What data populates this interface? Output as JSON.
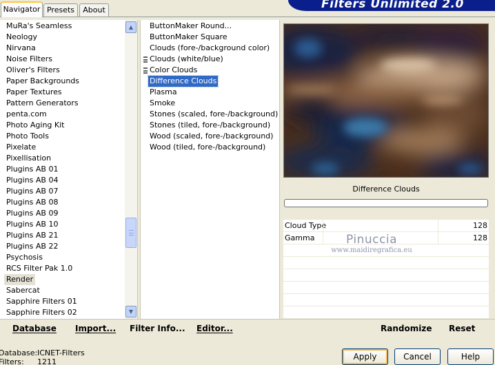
{
  "tabs": [
    {
      "label": "Navigator"
    },
    {
      "label": "Presets"
    },
    {
      "label": "About"
    }
  ],
  "banner": {
    "title": "Filters Unlimited 2.0"
  },
  "categories": [
    {
      "label": "MuRa's Seamless"
    },
    {
      "label": "Neology"
    },
    {
      "label": "Nirvana"
    },
    {
      "label": "Noise Filters"
    },
    {
      "label": "Oliver's Filters"
    },
    {
      "label": "Paper Backgrounds"
    },
    {
      "label": "Paper Textures"
    },
    {
      "label": "Pattern Generators"
    },
    {
      "label": "penta.com"
    },
    {
      "label": "Photo Aging Kit"
    },
    {
      "label": "Photo Tools"
    },
    {
      "label": "Pixelate"
    },
    {
      "label": "Pixellisation"
    },
    {
      "label": "Plugins AB 01"
    },
    {
      "label": "Plugins AB 04"
    },
    {
      "label": "Plugins AB 07"
    },
    {
      "label": "Plugins AB 08"
    },
    {
      "label": "Plugins AB 09"
    },
    {
      "label": "Plugins AB 10"
    },
    {
      "label": "Plugins AB 21"
    },
    {
      "label": "Plugins AB 22"
    },
    {
      "label": "Psychosis"
    },
    {
      "label": "RCS Filter Pak 1.0"
    },
    {
      "label": "Render"
    },
    {
      "label": "Sabercat"
    },
    {
      "label": "Sapphire Filters 01"
    },
    {
      "label": "Sapphire Filters 02"
    }
  ],
  "filters": [
    {
      "label": "ButtonMaker Round..."
    },
    {
      "label": "ButtonMaker Square"
    },
    {
      "label": "Clouds (fore-/background color)"
    },
    {
      "label": "Clouds (white/blue)"
    },
    {
      "label": "Color Clouds"
    },
    {
      "label": "Difference Clouds"
    },
    {
      "label": "Plasma"
    },
    {
      "label": "Smoke"
    },
    {
      "label": "Stones (scaled, fore-/background)"
    },
    {
      "label": "Stones (tiled, fore-/background)"
    },
    {
      "label": "Wood (scaled, fore-/background)"
    },
    {
      "label": "Wood (tiled, fore-/background)"
    }
  ],
  "preview": {
    "filter_name": "Difference Clouds"
  },
  "params": [
    {
      "name": "Cloud Type",
      "value": "128"
    },
    {
      "name": "Gamma",
      "value": "128"
    }
  ],
  "watermark": {
    "name": "Pinuccia",
    "url": "www.maidiregrafica.eu"
  },
  "actions": {
    "database": "Database",
    "import": "Import...",
    "filter_info": "Filter Info...",
    "editor": "Editor...",
    "randomize": "Randomize",
    "reset": "Reset"
  },
  "status": {
    "database_label": "Database:",
    "database_value": "ICNET-Filters",
    "filters_label": "Filters:",
    "filters_value": "1211"
  },
  "buttons": {
    "apply": "Apply",
    "cancel": "Cancel",
    "help": "Help"
  }
}
